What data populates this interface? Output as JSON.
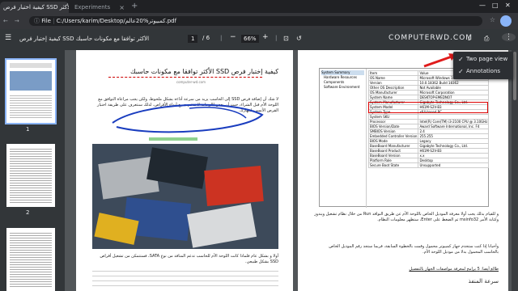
{
  "browser": {
    "tabs": [
      {
        "title": "كيفية اختبار فرص SSD الأكثر",
        "active": true
      },
      {
        "title": "Experiments",
        "active": false
      }
    ],
    "address": {
      "scheme_label": "File",
      "url": "C:/Users/karim/Desktop/كمبيوتر%20عالم.pdf"
    }
  },
  "pdf_toolbar": {
    "title": "الأكثر توافقا مع مكونات حاسبك SSD كيفية إختبار فرص",
    "page_current": "1",
    "page_total": "/ 6",
    "zoom": "66%"
  },
  "watermark": "COMPUTERWD.COM",
  "thumbnails": [
    {
      "label": "1"
    },
    {
      "label": "2"
    }
  ],
  "page1": {
    "heading": "كيفية إختبار فرص SSD الأكثر توافقا مع مكونات حاسبك",
    "byline": "computer-wd.com",
    "body": "لا شك أن إضافة قرص SSD إلى الحاسب يزيد من سرعة أداءه بشكل ملحوظ، ولكن يجب مراعاة التوافق مع اللوحة الأم قبل الشراء، حيث أن بعض اللوحات لا تدعم جميع أنواع الأقراص، لذلك سنتعرف على طريقة اختبار القرص الأنسب لجهازك.",
    "caption": "أولا و بشكل عام فلماذا كانت اللوحة الأم للحاسب تدعم المنافذ من نوع SATA، فستتمكن من تشغيل أقراص SSD بشكل طبيعي."
  },
  "page2": {
    "table_header": [
      "Item",
      "Value"
    ],
    "table_rows": [
      [
        "OS Name",
        "Microsoft Windows 10 Pro"
      ],
      [
        "Version",
        "10.0.18362 Build 18362"
      ],
      [
        "Other OS Description",
        "Not Available"
      ],
      [
        "OS Manufacturer",
        "Microsoft Corporation"
      ],
      [
        "System Name",
        "DESKTOP-EMEDNO7"
      ],
      [
        "System Manufacturer",
        "Gigabyte Technology Co., Ltd."
      ],
      [
        "System Model",
        "H61M-S2V-B3"
      ],
      [
        "System Type",
        "x64-based PC"
      ],
      [
        "System SKU",
        ""
      ],
      [
        "Processor",
        "Intel(R) Core(TM) i3-2100 CPU @ 3.10GHz"
      ],
      [
        "BIOS Version/Date",
        "Award Software International, Inc. F4"
      ],
      [
        "SMBIOS Version",
        "2.4"
      ],
      [
        "Embedded Controller Version",
        "255.255"
      ],
      [
        "BIOS Mode",
        "Legacy"
      ],
      [
        "BaseBoard Manufacturer",
        "Gigabyte Technology Co., Ltd."
      ],
      [
        "BaseBoard Product",
        "H61M-S2V-B3"
      ],
      [
        "BaseBoard Version",
        "x.x"
      ],
      [
        "Platform Role",
        "Desktop"
      ],
      [
        "Secure Boot State",
        "Unsupported"
      ]
    ],
    "tree": [
      "System Summary",
      "Hardware Resources",
      "Components",
      "Software Environment"
    ],
    "para1": "و للقيام بذلك يجب أولا معرفة الموديل الخاص باللوحة الأم عن طريق النوافذ Run من خلال نظام تشغيل ويندوز وكتابة الأمر msinfo32 ثم الضغط على Enter، ستظهر معلومات النظام.",
    "para2": "وأحيانا إذا كنت ستجدم جهاز كمبيوتر محمول وقمت بالخطوة السابقة، فربما ستجد رقم الموديل الخاص بالحاسب المحمول بدلا من موديل اللوحة الأم.",
    "link": "طالع أيضا: 5 برامج لمعرفة مواصفات الجهاز بالتفصيل",
    "subhead": "سرعة المنفذ"
  },
  "menu": {
    "items": [
      {
        "label": "Two page view",
        "checked": true
      },
      {
        "label": "Annotations",
        "checked": true
      }
    ]
  }
}
